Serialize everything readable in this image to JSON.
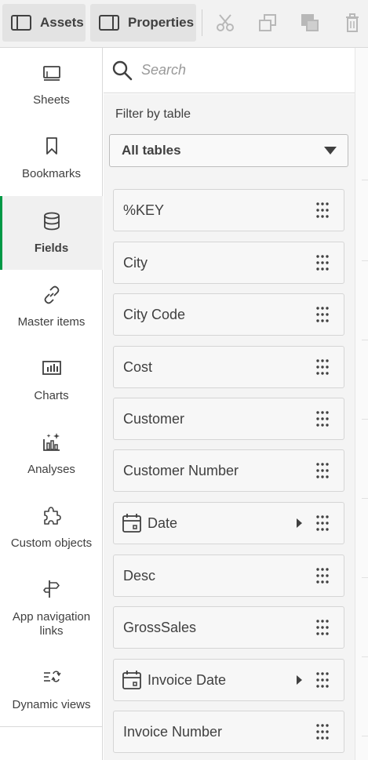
{
  "toolbar": {
    "assets_label": "Assets",
    "properties_label": "Properties",
    "icons": [
      "cut-icon",
      "copy-icon",
      "duplicate-icon",
      "delete-icon"
    ]
  },
  "sidebar": {
    "items": [
      {
        "label": "Sheets",
        "icon": "sheet-icon"
      },
      {
        "label": "Bookmarks",
        "icon": "bookmark-icon"
      },
      {
        "label": "Fields",
        "icon": "database-icon",
        "active": true
      },
      {
        "label": "Master items",
        "icon": "link-icon"
      },
      {
        "label": "Charts",
        "icon": "bar-chart-icon"
      },
      {
        "label": "Analyses",
        "icon": "sparkle-chart-icon"
      },
      {
        "label": "Custom objects",
        "icon": "puzzle-icon"
      },
      {
        "label": "App navigation links",
        "icon": "signpost-icon"
      },
      {
        "label": "Dynamic views",
        "icon": "dynamic-views-icon"
      }
    ]
  },
  "search": {
    "placeholder": "Search"
  },
  "filter": {
    "label": "Filter by table",
    "selected": "All tables"
  },
  "fields": [
    {
      "name": "%KEY",
      "type": "text"
    },
    {
      "name": "City",
      "type": "text"
    },
    {
      "name": "City Code",
      "type": "text"
    },
    {
      "name": "Cost",
      "type": "text"
    },
    {
      "name": "Customer",
      "type": "text"
    },
    {
      "name": "Customer Number",
      "type": "text"
    },
    {
      "name": "Date",
      "type": "date"
    },
    {
      "name": "Desc",
      "type": "text"
    },
    {
      "name": "GrossSales",
      "type": "text"
    },
    {
      "name": "Invoice Date",
      "type": "date"
    },
    {
      "name": "Invoice Number",
      "type": "text"
    }
  ],
  "colors": {
    "accent": "#009845"
  }
}
